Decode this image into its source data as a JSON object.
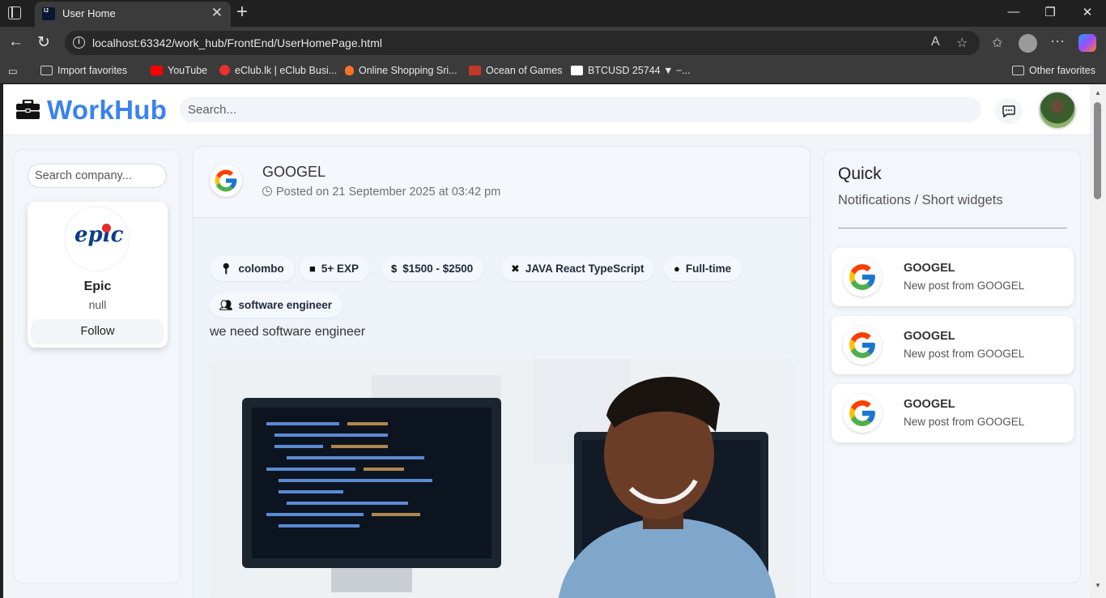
{
  "browser": {
    "tab_title": "User Home",
    "url": "localhost:63342/work_hub/FrontEnd/UserHomePage.html",
    "bookmarks": [
      {
        "label": "Import favorites",
        "color": "#cfcfcf"
      },
      {
        "label": "YouTube",
        "color": "#ff0000"
      },
      {
        "label": "eClub.lk | eClub Busi...",
        "color": "#e5322d"
      },
      {
        "label": "Online Shopping Sri...",
        "color": "#f57224"
      },
      {
        "label": "Ocean of Games",
        "color": "#c0392b"
      },
      {
        "label": "BTCUSD 25744 ▼ −...",
        "color": "#ffffff"
      }
    ],
    "other_favorites": "Other favorites"
  },
  "header": {
    "brand": "WorkHub",
    "brand_color": "#3a82f0",
    "search_placeholder": "Search..."
  },
  "sidebar": {
    "company_search_placeholder": "Search company...",
    "company": {
      "logo_text": "epic",
      "name": "Epic",
      "subtitle": "null",
      "follow_label": "Follow"
    }
  },
  "post": {
    "company": "GOOGEL",
    "posted": "Posted on 21 September 2025 at 03:42 pm",
    "chips": {
      "location": "colombo",
      "experience": "5+ EXP",
      "salary": "$1500 - $2500",
      "skills": "JAVA React TypeScript",
      "job_type": "Full-time",
      "role": "software engineer"
    },
    "description": "we need software engineer"
  },
  "quick": {
    "title": "Quick",
    "subtitle": "Notifications / Short widgets",
    "notifications": [
      {
        "title": "GOOGEL",
        "text": "New post from GOOGEL"
      },
      {
        "title": "GOOGEL",
        "text": "New post from GOOGEL"
      },
      {
        "title": "GOOGEL",
        "text": "New post from GOOGEL"
      }
    ]
  }
}
